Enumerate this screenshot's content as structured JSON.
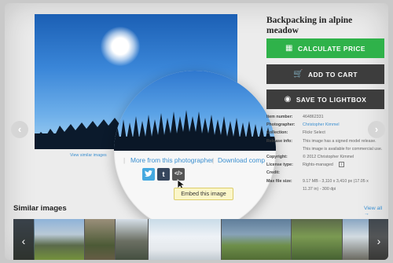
{
  "product": {
    "title": "Backpacking in alpine meadow"
  },
  "buttons": {
    "calculate": "CALCULATE PRICE",
    "cart": "ADD TO CART",
    "lightbox": "SAVE TO LIGHTBOX"
  },
  "photo_links": {
    "view_similar": "View similar images"
  },
  "magnifier": {
    "more_from": "More from this photographer",
    "separator": "|",
    "download": "Download comp",
    "twitter": "t",
    "tumblr": "t",
    "embed": "</>",
    "tooltip": "Embed this image"
  },
  "meta": [
    {
      "key": "Item number:",
      "value": "464862331"
    },
    {
      "key": "Photographer:",
      "value": "Christopher Kimmel"
    },
    {
      "key": "Collection:",
      "value": "Flickr Select"
    },
    {
      "key": "Release info:",
      "value": "This image has a signed model release."
    },
    {
      "key": "",
      "value": "This image is available for commercial use."
    },
    {
      "key": "Copyright:",
      "value": "© 2012 Christopher Kimmel"
    },
    {
      "key": "License type:",
      "value": "Rights-managed"
    },
    {
      "key": "Credit:",
      "value": ""
    },
    {
      "key": "Max file size:",
      "value": "9.17 MB - 3,110 x 3,410 px (17.05 x"
    },
    {
      "key": "",
      "value": "11.37 in) - 300 dpi"
    }
  ],
  "similar": {
    "title": "Similar images",
    "view_all": "View all →"
  },
  "colors": {
    "accent_green": "#2fb24a",
    "dark_button": "#3d3d3d",
    "link_blue": "#3b8fd0",
    "twitter": "#45a9e0",
    "tumblr": "#36465d",
    "embed": "#555555"
  },
  "icons": [
    "calculator-icon",
    "cart-icon",
    "lightbox-icon",
    "twitter-icon",
    "tumblr-icon",
    "embed-icon",
    "mouse-cursor-icon",
    "info-icon"
  ]
}
